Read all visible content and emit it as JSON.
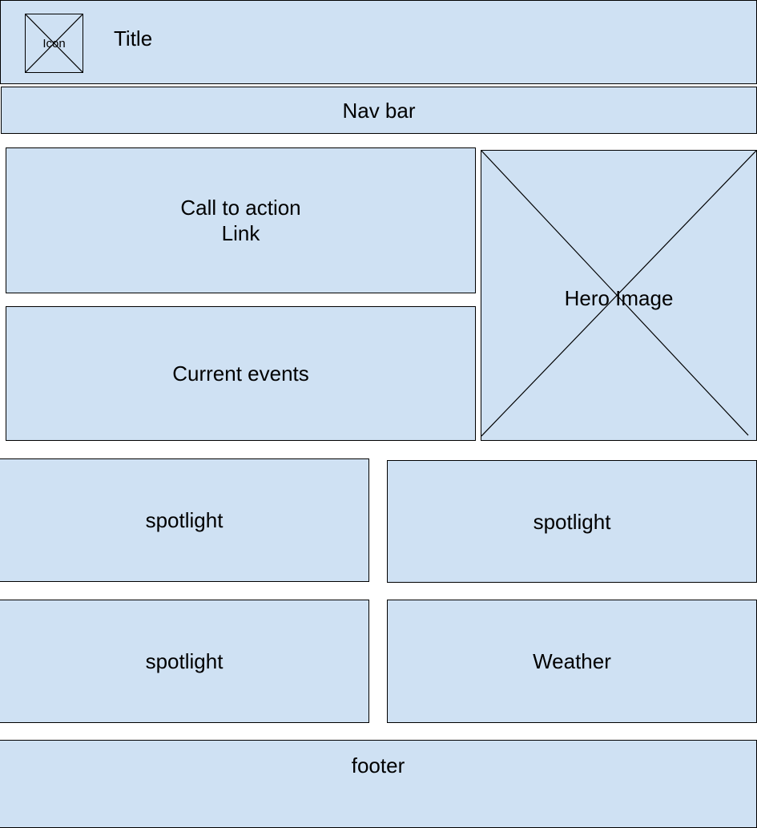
{
  "header": {
    "icon_label": "Icon",
    "title": "Title"
  },
  "nav": {
    "label": "Nav bar"
  },
  "call_to_action": {
    "line1": "Call to action",
    "line2": "Link"
  },
  "current_events": {
    "label": "Current events"
  },
  "hero": {
    "label": "Hero Image"
  },
  "spotlights": [
    {
      "label": "spotlight"
    },
    {
      "label": "spotlight"
    },
    {
      "label": "spotlight"
    }
  ],
  "weather": {
    "label": "Weather"
  },
  "footer": {
    "label": "footer"
  },
  "colors": {
    "box_fill": "#cfe1f3",
    "stroke": "#000000"
  },
  "icons": [
    "image-placeholder-icon"
  ]
}
